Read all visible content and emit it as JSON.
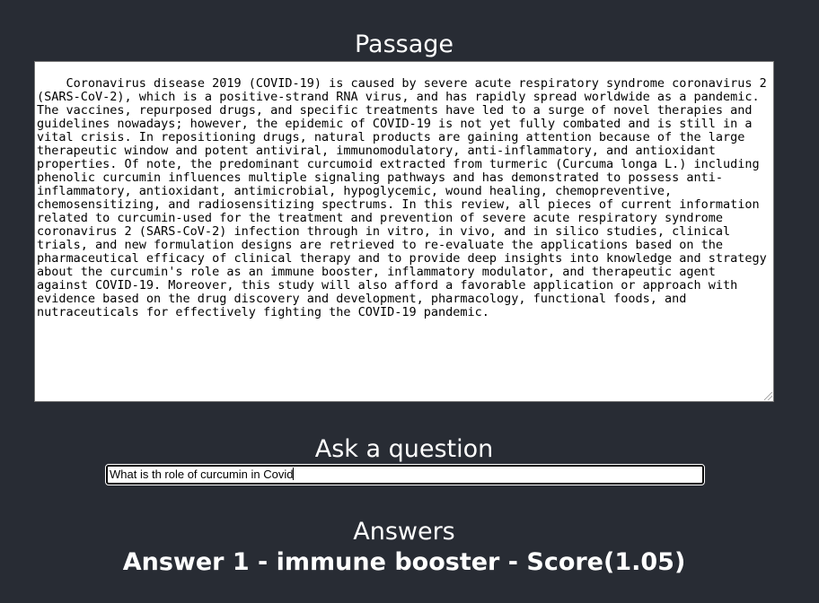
{
  "passage_section": {
    "title": "Passage",
    "text": "Coronavirus disease 2019 (COVID-19) is caused by severe acute respiratory syndrome coronavirus 2 (SARS-CoV-2), which is a positive-strand RNA virus, and has rapidly spread worldwide as a pandemic. The vaccines, repurposed drugs, and specific treatments have led to a surge of novel therapies and guidelines nowadays; however, the epidemic of COVID-19 is not yet fully combated and is still in a vital crisis. In repositioning drugs, natural products are gaining attention because of the large therapeutic window and potent antiviral, immunomodulatory, anti-inflammatory, and antioxidant properties. Of note, the predominant curcumoid extracted from turmeric (Curcuma longa L.) including phenolic curcumin influences multiple signaling pathways and has demonstrated to possess anti-inflammatory, antioxidant, antimicrobial, hypoglycemic, wound healing, chemopreventive, chemosensitizing, and radiosensitizing spectrums. In this review, all pieces of current information related to curcumin-used for the treatment and prevention of severe acute respiratory syndrome coronavirus 2 (SARS-CoV-2) infection through in vitro, in vivo, and in silico studies, clinical trials, and new formulation designs are retrieved to re-evaluate the applications based on the pharmaceutical efficacy of clinical therapy and to provide deep insights into knowledge and strategy about the curcumin's role as an immune booster, inflammatory modulator, and therapeutic agent against COVID-19. Moreover, this study will also afford a favorable application or approach with evidence based on the drug discovery and development, pharmacology, functional foods, and nutraceuticals for effectively fighting the COVID-19 pandemic."
  },
  "question_section": {
    "title": "Ask a question",
    "value": "What is th role of curcumin in Covid"
  },
  "answers_section": {
    "title": "Answers",
    "items": [
      {
        "text": "Answer 1 - immune booster - Score(1.05)"
      }
    ]
  }
}
